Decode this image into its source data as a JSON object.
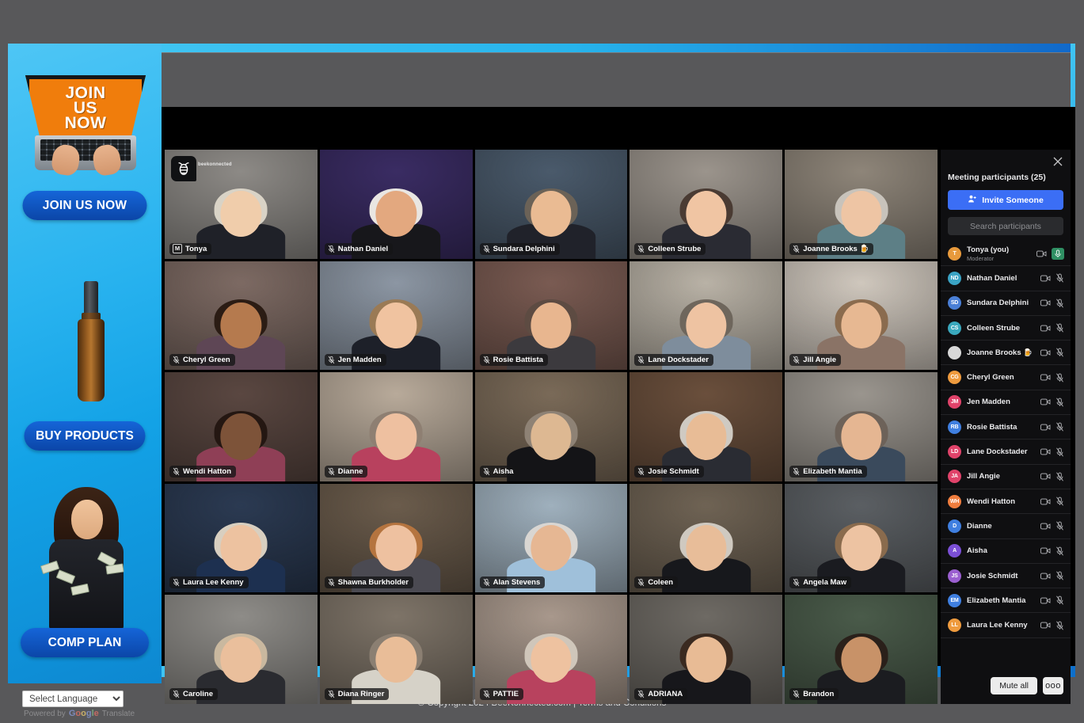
{
  "sidebar": {
    "promo_banner_text": "JOIN\nUS\nNOW",
    "join_label": "JOIN US NOW",
    "buy_label": "BUY PRODUCTS",
    "comp_label": "COMP PLAN"
  },
  "footer": {
    "language_selected": "Select Language",
    "powered_by": "Powered by",
    "google": "Google",
    "translate": "Translate",
    "copyright": "© Copyright 2024 BeeKonnected.com |",
    "terms": "Terms and Conditions"
  },
  "meeting": {
    "watermark_brand": "beekonnected",
    "tiles": [
      {
        "name": "Tonya",
        "active": true,
        "moderator": true,
        "muted": false,
        "bg": "#8d8a86",
        "body": "#1f2128",
        "skin": "#f0cdab",
        "hair": "#d9d3c6"
      },
      {
        "name": "Nathan Daniel",
        "active": false,
        "moderator": false,
        "muted": true,
        "bg": "#3a2c63",
        "body": "#17171b",
        "skin": "#e3a87f",
        "hair": "#e9e6e2"
      },
      {
        "name": "Sundara Delphini",
        "active": false,
        "moderator": false,
        "muted": true,
        "bg": "#4a5a6b",
        "body": "#20222a",
        "skin": "#eabb93",
        "hair": "#6b6257"
      },
      {
        "name": "Colleen Strube",
        "active": false,
        "moderator": false,
        "muted": true,
        "bg": "#9b948c",
        "body": "#2a2b33",
        "skin": "#f0c5a3",
        "hair": "#4a3b33"
      },
      {
        "name": "Joanne Brooks 🍺",
        "active": false,
        "moderator": false,
        "muted": true,
        "bg": "#8e8579",
        "body": "#5d7f86",
        "skin": "#eec5a4",
        "hair": "#c8c3bb"
      },
      {
        "name": "Cheryl Green",
        "active": false,
        "moderator": false,
        "muted": true,
        "bg": "#7d6a63",
        "body": "#5e4655",
        "skin": "#b57a4e",
        "hair": "#2b1c14"
      },
      {
        "name": "Jen Madden",
        "active": false,
        "moderator": false,
        "muted": true,
        "bg": "#8c96a3",
        "body": "#1d2029",
        "skin": "#f0c3a0",
        "hair": "#9a7a55"
      },
      {
        "name": "Rosie Battista",
        "active": false,
        "moderator": false,
        "muted": true,
        "bg": "#7a5b52",
        "body": "#3c3a3e",
        "skin": "#e8b68f",
        "hair": "#5d4b42"
      },
      {
        "name": "Lane Dockstader",
        "active": false,
        "moderator": false,
        "muted": true,
        "bg": "#b9b2a6",
        "body": "#7e8d9c",
        "skin": "#eec3a2",
        "hair": "#6e665c"
      },
      {
        "name": "Jill Angie",
        "active": false,
        "moderator": false,
        "muted": true,
        "bg": "#cfc7bd",
        "body": "#8a7366",
        "skin": "#e7b892",
        "hair": "#8a6b4e"
      },
      {
        "name": "Wendi Hatton",
        "active": false,
        "moderator": false,
        "muted": true,
        "bg": "#5a4741",
        "body": "#8f3f56",
        "skin": "#7d5339",
        "hair": "#241712"
      },
      {
        "name": "Dianne",
        "active": false,
        "moderator": false,
        "muted": true,
        "bg": "#b8aa9a",
        "body": "#b8415e",
        "skin": "#eec0a0",
        "hair": "#8e7f72"
      },
      {
        "name": "Aisha",
        "active": false,
        "moderator": false,
        "muted": true,
        "bg": "#7a6a58",
        "body": "#141417",
        "skin": "#ddb892",
        "hair": "#8e8275"
      },
      {
        "name": "Josie Schmidt",
        "active": false,
        "moderator": false,
        "muted": true,
        "bg": "#6a4f3c",
        "body": "#2a2c33",
        "skin": "#e8bc96",
        "hair": "#cfcac2"
      },
      {
        "name": "Elizabeth Mantia",
        "active": false,
        "moderator": false,
        "muted": true,
        "bg": "#9a958e",
        "body": "#3a4a5c",
        "skin": "#e5b692",
        "hair": "#6d6259"
      },
      {
        "name": "Laura Lee Kenny",
        "active": false,
        "moderator": false,
        "muted": true,
        "bg": "#2b3a52",
        "body": "#1d3050",
        "skin": "#edc2a0",
        "hair": "#d8cfc0"
      },
      {
        "name": "Shawna Burkholder",
        "active": false,
        "moderator": false,
        "muted": true,
        "bg": "#6b5c4c",
        "body": "#4b4a52",
        "skin": "#eec1a0",
        "hair": "#b5743f"
      },
      {
        "name": "Alan Stevens",
        "active": false,
        "moderator": false,
        "muted": true,
        "bg": "#9fb0bd",
        "body": "#9fc0da",
        "skin": "#e6b793",
        "hair": "#d9d6d2"
      },
      {
        "name": "Coleen",
        "active": false,
        "moderator": false,
        "muted": true,
        "bg": "#6f6354",
        "body": "#17181c",
        "skin": "#e8bd99",
        "hair": "#cfc9c0"
      },
      {
        "name": "Angela Maw",
        "active": false,
        "moderator": false,
        "muted": true,
        "bg": "#5b5f63",
        "body": "#1a1b20",
        "skin": "#edc3a2",
        "hair": "#8a6b4d"
      },
      {
        "name": "Caroline",
        "active": false,
        "moderator": false,
        "muted": true,
        "bg": "#8e8c88",
        "body": "#2a2b30",
        "skin": "#eabf9c",
        "hair": "#c9b89f"
      },
      {
        "name": "Diana Ringer",
        "active": false,
        "moderator": false,
        "muted": true,
        "bg": "#7e7468",
        "body": "#d6d2c8",
        "skin": "#e9bd98",
        "hair": "#8b7f72"
      },
      {
        "name": "PATTIE",
        "active": false,
        "moderator": false,
        "muted": true,
        "bg": "#a8988c",
        "body": "#b8425e",
        "skin": "#eec2a0",
        "hair": "#cfc6ba"
      },
      {
        "name": "ADRIANA",
        "active": false,
        "moderator": false,
        "muted": true,
        "bg": "#6e6a64",
        "body": "#17171b",
        "skin": "#e8bb95",
        "hair": "#3a2a20"
      },
      {
        "name": "Brandon",
        "active": false,
        "moderator": false,
        "muted": true,
        "bg": "#4a5b4a",
        "body": "#1b1c20",
        "skin": "#c89268",
        "hair": "#2a201a"
      }
    ]
  },
  "participants_panel": {
    "title": "Meeting participants (25)",
    "invite_label": "Invite Someone",
    "search_placeholder": "Search participants",
    "mute_all_label": "Mute all",
    "more_label": "ooo",
    "items": [
      {
        "name": "Tonya (you)",
        "role": "Moderator",
        "initials": "T",
        "color": "#e89a3c",
        "mic_on": true
      },
      {
        "name": "Nathan Daniel",
        "role": "",
        "initials": "ND",
        "color": "#3aa3c4",
        "mic_on": false
      },
      {
        "name": "Sundara Delphini",
        "role": "",
        "initials": "SD",
        "color": "#4a7fd6",
        "mic_on": false
      },
      {
        "name": "Colleen Strube",
        "role": "",
        "initials": "CS",
        "color": "#3aa8bd",
        "mic_on": false
      },
      {
        "name": "Joanne Brooks 🍺",
        "role": "",
        "initials": "",
        "color": "#d8d8d8",
        "mic_on": false
      },
      {
        "name": "Cheryl Green",
        "role": "",
        "initials": "CG",
        "color": "#ef9b3e",
        "mic_on": false
      },
      {
        "name": "Jen Madden",
        "role": "",
        "initials": "JM",
        "color": "#e0436a",
        "mic_on": false
      },
      {
        "name": "Rosie Battista",
        "role": "",
        "initials": "RB",
        "color": "#3f7fe0",
        "mic_on": false
      },
      {
        "name": "Lane Dockstader",
        "role": "",
        "initials": "LD",
        "color": "#e0436a",
        "mic_on": false
      },
      {
        "name": "Jill Angie",
        "role": "",
        "initials": "JA",
        "color": "#e0436a",
        "mic_on": false
      },
      {
        "name": "Wendi Hatton",
        "role": "",
        "initials": "WH",
        "color": "#ef7d3e",
        "mic_on": false
      },
      {
        "name": "Dianne",
        "role": "",
        "initials": "D",
        "color": "#3f7fe0",
        "mic_on": false
      },
      {
        "name": "Aisha",
        "role": "",
        "initials": "A",
        "color": "#7b4fd6",
        "mic_on": false
      },
      {
        "name": "Josie Schmidt",
        "role": "",
        "initials": "JS",
        "color": "#9b5fd0",
        "mic_on": false
      },
      {
        "name": "Elizabeth Mantia",
        "role": "",
        "initials": "EM",
        "color": "#3f7fe0",
        "mic_on": false
      },
      {
        "name": "Laura Lee Kenny",
        "role": "",
        "initials": "LL",
        "color": "#ef9b3e",
        "mic_on": false
      }
    ]
  }
}
